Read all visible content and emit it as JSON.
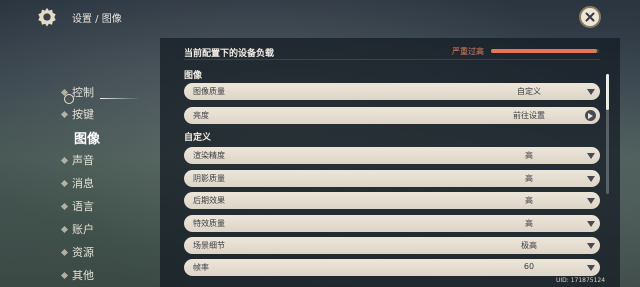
{
  "breadcrumb": "设置 / 图像",
  "sidebar": {
    "items": [
      {
        "label": "控制"
      },
      {
        "label": "按键"
      },
      {
        "label": "图像",
        "active": true
      },
      {
        "label": "声音"
      },
      {
        "label": "消息"
      },
      {
        "label": "语言"
      },
      {
        "label": "账户"
      },
      {
        "label": "资源"
      },
      {
        "label": "其他"
      }
    ]
  },
  "load": {
    "title": "当前配置下的设备负载",
    "status": "严重过高",
    "level_fraction": 0.98,
    "color": "#e07a55"
  },
  "sections": {
    "image": "图像",
    "custom": "自定义"
  },
  "rows": [
    {
      "label": "图像质量",
      "value": "自定义",
      "control": "dropdown"
    },
    {
      "label": "亮度",
      "value": "前往设置",
      "control": "goto"
    },
    {
      "label": "渲染精度",
      "value": "高",
      "control": "dropdown"
    },
    {
      "label": "阴影质量",
      "value": "高",
      "control": "dropdown"
    },
    {
      "label": "后期效果",
      "value": "高",
      "control": "dropdown"
    },
    {
      "label": "特效质量",
      "value": "高",
      "control": "dropdown"
    },
    {
      "label": "场景细节",
      "value": "极高",
      "control": "dropdown"
    },
    {
      "label": "帧率",
      "value": "60",
      "control": "dropdown"
    }
  ],
  "uid": "UID: 171875124",
  "icons": {
    "settings": "gear-icon",
    "close": "close-icon",
    "dropdown": "caret-down-icon",
    "goto": "arrow-right-circle-icon"
  }
}
